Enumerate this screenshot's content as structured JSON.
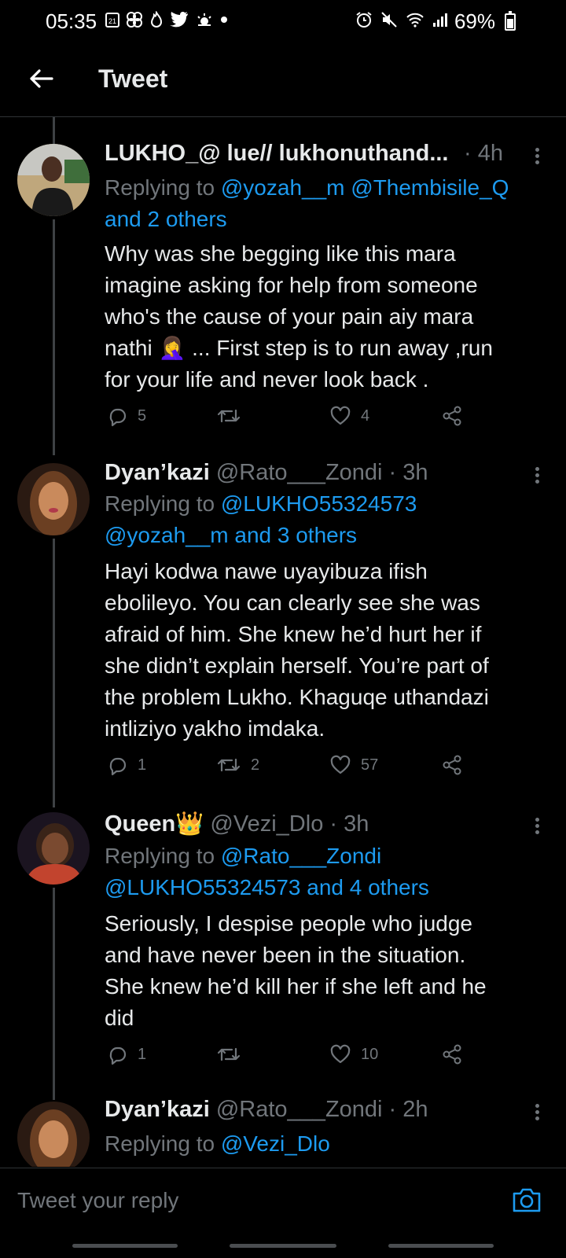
{
  "status_bar": {
    "time": "05:35",
    "battery_text": "69%",
    "battery_level": 0.69,
    "left_icons": [
      "calendar-icon",
      "pinwheel-icon",
      "fire-icon",
      "twitter-bird-icon",
      "weather-icon",
      "dot-icon"
    ],
    "right_icons": [
      "alarm-icon",
      "mute-icon",
      "wifi-icon",
      "signal-icon",
      "battery-icon"
    ]
  },
  "header": {
    "title": "Tweet"
  },
  "tweets": [
    {
      "name": "LUKHO_@ lue// lukhonuthand...",
      "handle": "",
      "time": "· 4h",
      "replying_prefix": "Replying to",
      "replying_line1": "@yozah__m @Thembisile_Q",
      "replying_line2": "and 2 others",
      "body": [
        "Why was she begging like this mara",
        "imagine asking for help from someone",
        "who's the cause of your pain aiy mara",
        "nathi 🤦‍♀️ ... First step is to run away ,run",
        "for your life and never look back ."
      ],
      "replies": "5",
      "retweets": "",
      "likes": "4"
    },
    {
      "name": "Dyan’kazi",
      "handle": "@Rato___Zondi",
      "time": "· 3h",
      "replying_prefix": "Replying to",
      "replying_line1": "@LUKHO55324573",
      "replying_line2": "@yozah__m and 3 others",
      "body": [
        "Hayi kodwa nawe uyayibuza ifish",
        "ebolileyo. You can clearly see she was",
        "afraid of him. She knew he’d hurt her if",
        "she didn’t explain herself. You’re part of",
        "the problem Lukho. Khaguqe uthandazi",
        "intliziyo yakho imdaka."
      ],
      "replies": "1",
      "retweets": "2",
      "likes": "57"
    },
    {
      "name": "Queen👑",
      "handle": "@Vezi_Dlo",
      "time": "· 3h",
      "replying_prefix": "Replying to",
      "replying_line1": "@Rato___Zondi",
      "replying_line2": "@LUKHO55324573 and 4 others",
      "body": [
        "Seriously, I despise people who judge",
        "and have never been in the situation.",
        "She knew he’d kill her if she left and he",
        "did"
      ],
      "replies": "1",
      "retweets": "",
      "likes": "10"
    },
    {
      "name": "Dyan’kazi",
      "handle": "@Rato___Zondi",
      "time": "· 2h",
      "replying_prefix": "Replying to",
      "replying_line1": "@Vezi_Dlo"
    }
  ],
  "composer": {
    "placeholder": "Tweet your reply"
  },
  "colors": {
    "background": "#000000",
    "accent": "#1d9bf0",
    "muted": "#71767b",
    "text": "#e7e9ea"
  }
}
